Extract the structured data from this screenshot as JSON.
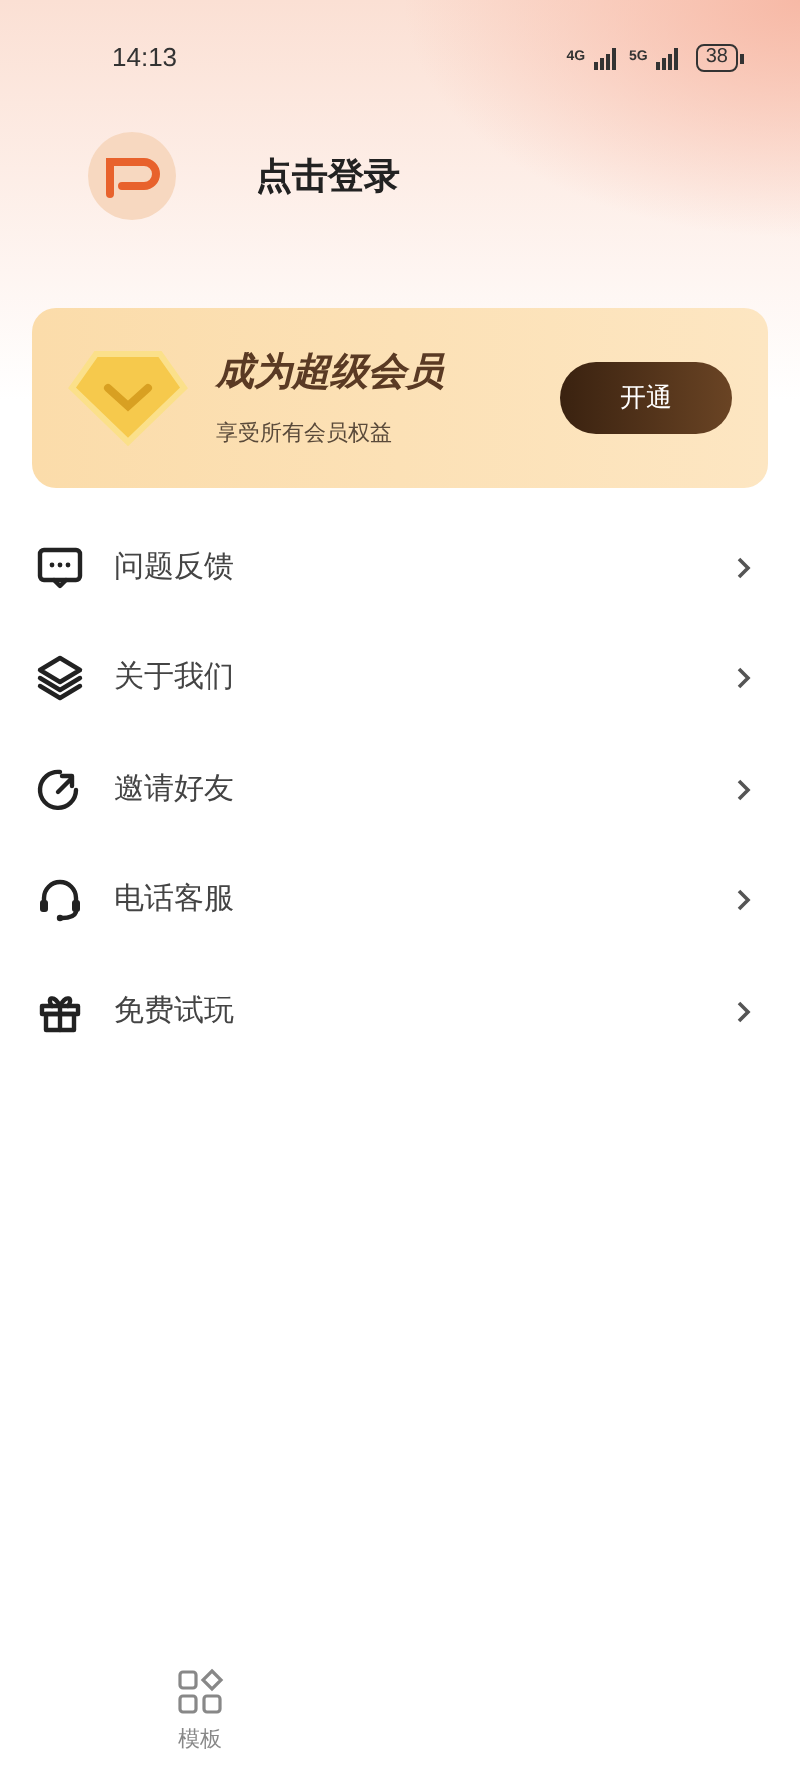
{
  "status_bar": {
    "time": "14:13",
    "network_1": "4G",
    "network_2": "5G",
    "battery": "38"
  },
  "profile": {
    "login_label": "点击登录"
  },
  "vip_card": {
    "title": "成为超级会员",
    "subtitle": "享受所有会员权益",
    "button": "开通"
  },
  "menu": [
    {
      "kind": "feedback",
      "label": "问题反馈"
    },
    {
      "kind": "about",
      "label": "关于我们"
    },
    {
      "kind": "invite",
      "label": "邀请好友"
    },
    {
      "kind": "service",
      "label": "电话客服"
    },
    {
      "kind": "gift",
      "label": "免费试玩"
    }
  ],
  "tab_bar": [
    {
      "label": "模板",
      "selected": false
    }
  ]
}
